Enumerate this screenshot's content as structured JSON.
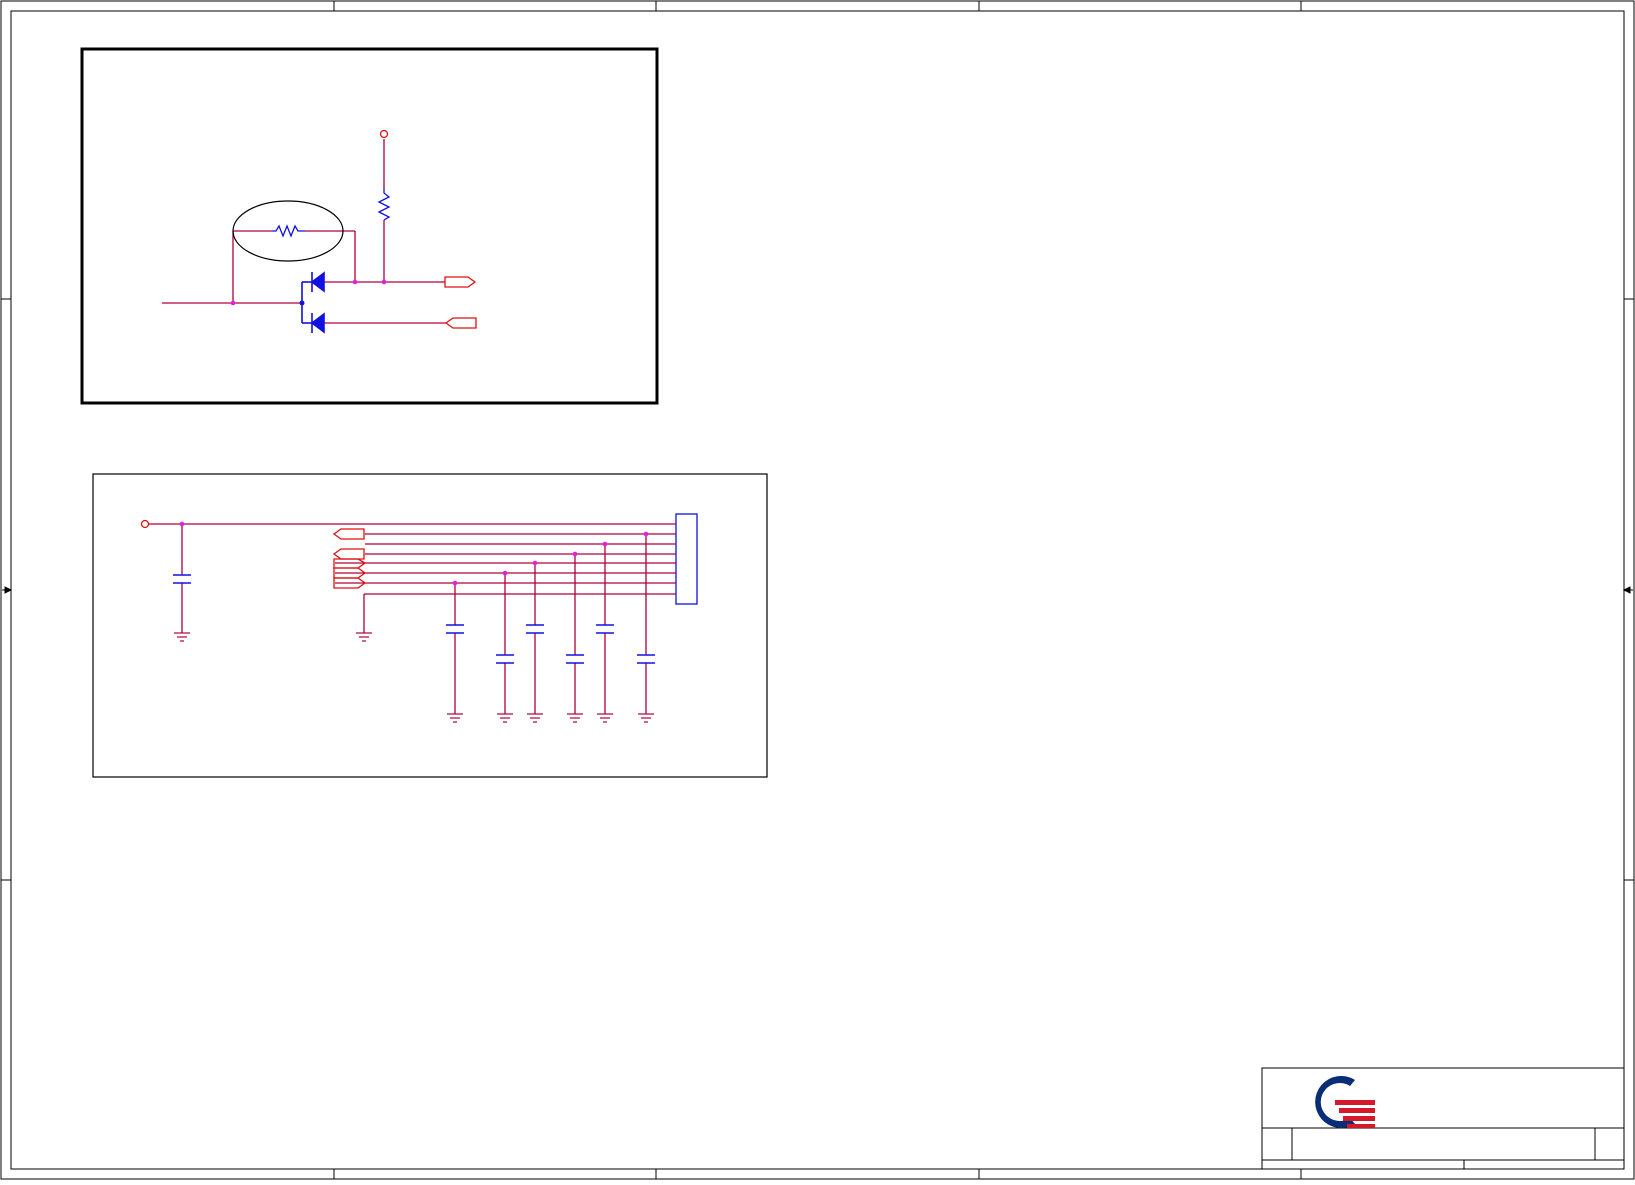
{
  "colors": {
    "frame": "#000000",
    "wire": "#b0003a",
    "part": "#1010e0",
    "port": "#e01010",
    "junction": "#e020e0",
    "logo_blue": "#0a2d78",
    "logo_red": "#d41a2a"
  },
  "icons": {
    "logo": "company-logo-icon",
    "ground": "ground-icon",
    "capacitor": "capacitor-icon",
    "resistor": "resistor-icon",
    "diode": "diode-icon",
    "port": "port-arrow-icon"
  },
  "title_block": {
    "text": ""
  }
}
